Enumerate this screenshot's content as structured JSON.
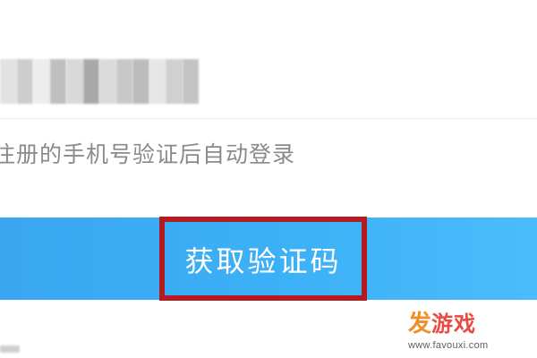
{
  "phone_field": {
    "masked": true,
    "blur_swatches": [
      "#e2e2e2",
      "#cdcdcd",
      "#ededed",
      "#bfbfbf",
      "#d9d9d9",
      "#a9a9a9",
      "#dadada",
      "#c8c8c8",
      "#bcbcbc",
      "#e6e6e6",
      "#d0d0d0",
      "#c4c4c4"
    ]
  },
  "hint": {
    "text": "注册的手机号验证后自动登录"
  },
  "get_code_button": {
    "label": "获取验证码",
    "bg_color": "#3cb0f6",
    "highlight_color": "#b31b22"
  },
  "watermark": {
    "logo_first": "发",
    "logo_rest": "游戏",
    "url": "www.favouxi.com"
  }
}
